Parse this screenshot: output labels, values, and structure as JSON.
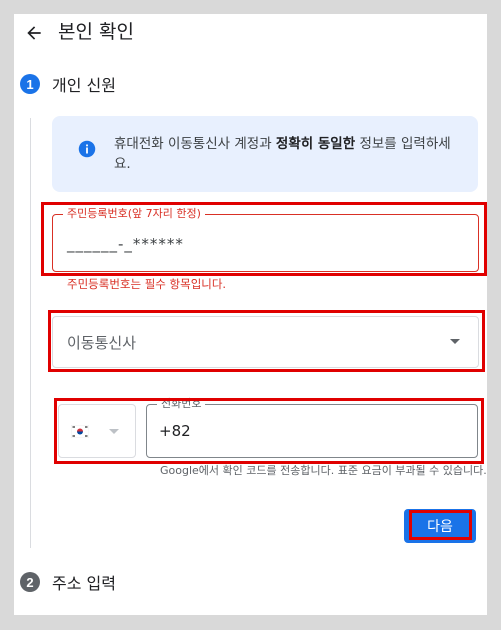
{
  "header": {
    "title": "본인 확인",
    "back_icon": "arrow-back-icon"
  },
  "steps": [
    {
      "number": "1",
      "label": "개인 신원",
      "color": "#1a73e8"
    },
    {
      "number": "2",
      "label": "주소 입력",
      "color": "#5f6368"
    }
  ],
  "info": {
    "text_before": "휴대전화 이동통신사 계정과 ",
    "text_bold": "정확히 동일한",
    "text_after": " 정보를 입력하세요.",
    "icon": "info-icon"
  },
  "id_field": {
    "label": "주민등록번호(앞 7자리 한정)",
    "value": "______-_******",
    "error": "주민등록번호는 필수 항목입니다."
  },
  "carrier_field": {
    "placeholder": "이동통신사"
  },
  "phone_field": {
    "label": "전화번호",
    "value": "+82",
    "country_flag": "korea-flag-icon",
    "helper": "Google에서 확인 코드를 전송합니다. 표준 요금이 부과될 수 있습니다."
  },
  "next_button": {
    "label": "다음"
  },
  "colors": {
    "accent": "#1a73e8",
    "error": "#d93025",
    "highlight": "#e00000"
  }
}
